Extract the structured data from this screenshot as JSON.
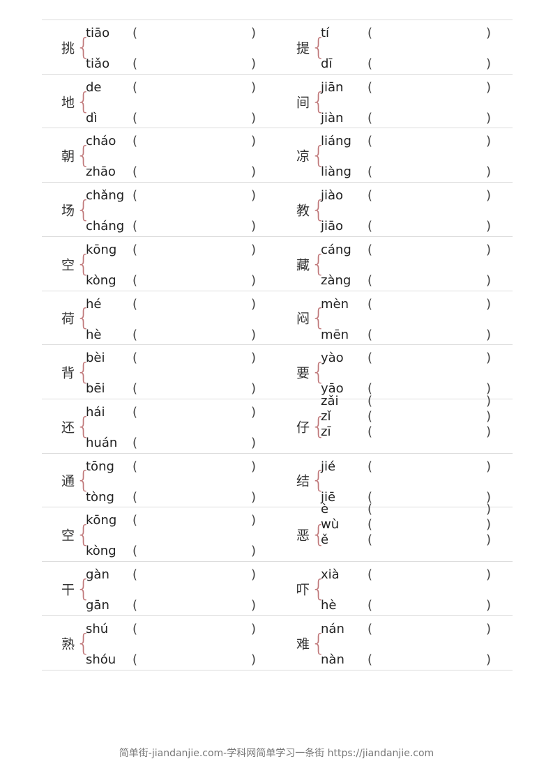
{
  "entries": [
    [
      {
        "char": "挑",
        "readings": [
          "tiāo",
          "tiǎo"
        ]
      },
      {
        "char": "提",
        "readings": [
          "tí",
          "dī"
        ]
      }
    ],
    [
      {
        "char": "地",
        "readings": [
          "de",
          "dì"
        ]
      },
      {
        "char": "间",
        "readings": [
          "jiān",
          "jiàn"
        ]
      }
    ],
    [
      {
        "char": "朝",
        "readings": [
          "cháo",
          "zhāo"
        ]
      },
      {
        "char": "凉",
        "readings": [
          "liáng",
          "liàng"
        ]
      }
    ],
    [
      {
        "char": "场",
        "readings": [
          "chǎng",
          "cháng"
        ]
      },
      {
        "char": "教",
        "readings": [
          "jiào",
          "jiāo"
        ]
      }
    ],
    [
      {
        "char": "空",
        "readings": [
          "kōng",
          "kòng"
        ]
      },
      {
        "char": "藏",
        "readings": [
          "cáng",
          "zàng"
        ]
      }
    ],
    [
      {
        "char": "荷",
        "readings": [
          "hé",
          "hè"
        ]
      },
      {
        "char": "闷",
        "readings": [
          "mèn",
          "mēn"
        ]
      }
    ],
    [
      {
        "char": "背",
        "readings": [
          "bèi",
          "bēi"
        ]
      },
      {
        "char": "要",
        "readings": [
          "yào",
          "yāo"
        ]
      }
    ],
    [
      {
        "char": "还",
        "readings": [
          "hái",
          "huán"
        ]
      },
      {
        "char": "仔",
        "readings": [
          "zǎi",
          "zǐ",
          "zī"
        ]
      }
    ],
    [
      {
        "char": "通",
        "readings": [
          "tōng",
          "tòng"
        ]
      },
      {
        "char": "结",
        "readings": [
          "jié",
          "jiē"
        ]
      }
    ],
    [
      {
        "char": "空",
        "readings": [
          "kōng",
          "kòng"
        ]
      },
      {
        "char": "恶",
        "readings": [
          "è",
          "wù",
          "ě"
        ]
      }
    ],
    [
      {
        "char": "干",
        "readings": [
          "gàn",
          "gān"
        ]
      },
      {
        "char": "吓",
        "readings": [
          "xià",
          "hè"
        ]
      }
    ],
    [
      {
        "char": "熟",
        "readings": [
          "shú",
          "shóu"
        ]
      },
      {
        "char": "难",
        "readings": [
          "nán",
          "nàn"
        ]
      }
    ]
  ],
  "paren_open": "(",
  "paren_close": ")",
  "brace": "{",
  "footer": "简单街-jiandanjie.com-学科网简单学习一条街 https://jiandanjie.com"
}
